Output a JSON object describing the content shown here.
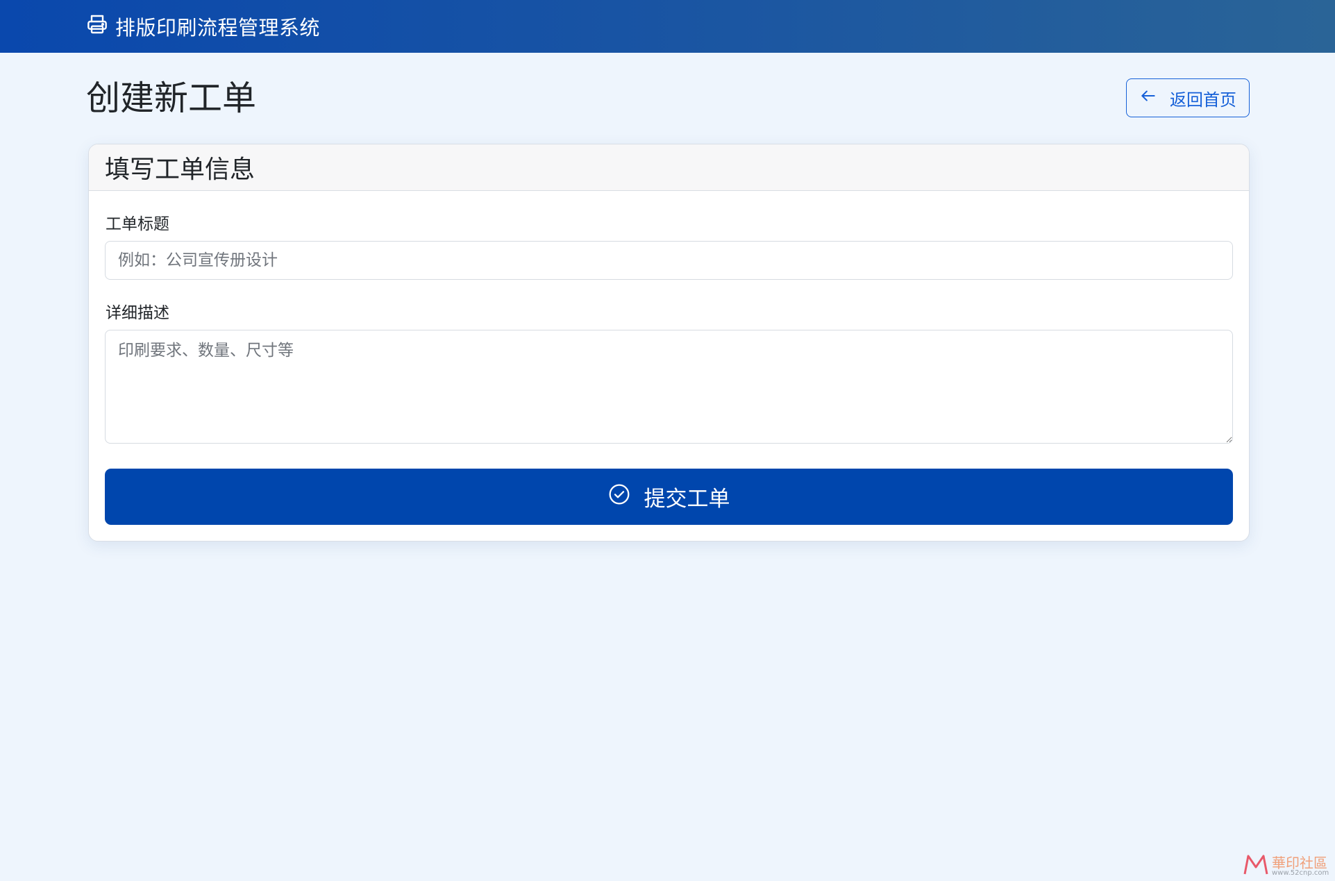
{
  "navbar": {
    "brand_icon": "printer-icon",
    "brand_title": "排版印刷流程管理系统"
  },
  "page": {
    "title": "创建新工单",
    "back_button_label": "返回首页",
    "back_button_icon": "arrow-left-icon"
  },
  "card": {
    "header": "填写工单信息",
    "fields": {
      "title_label": "工单标题",
      "title_placeholder": "例如：公司宣传册设计",
      "title_value": "",
      "description_label": "详细描述",
      "description_placeholder": "印刷要求、数量、尺寸等",
      "description_value": ""
    },
    "submit_label": "提交工单",
    "submit_icon": "check-circle-icon"
  },
  "watermark": {
    "text": "華印社區",
    "url": "www.52cnp.com"
  },
  "colors": {
    "navbar_start": "#0a48ad",
    "navbar_end": "#2a6497",
    "page_bg": "#eef5fd",
    "primary": "#0046ad",
    "outline_primary": "#1560d8"
  }
}
